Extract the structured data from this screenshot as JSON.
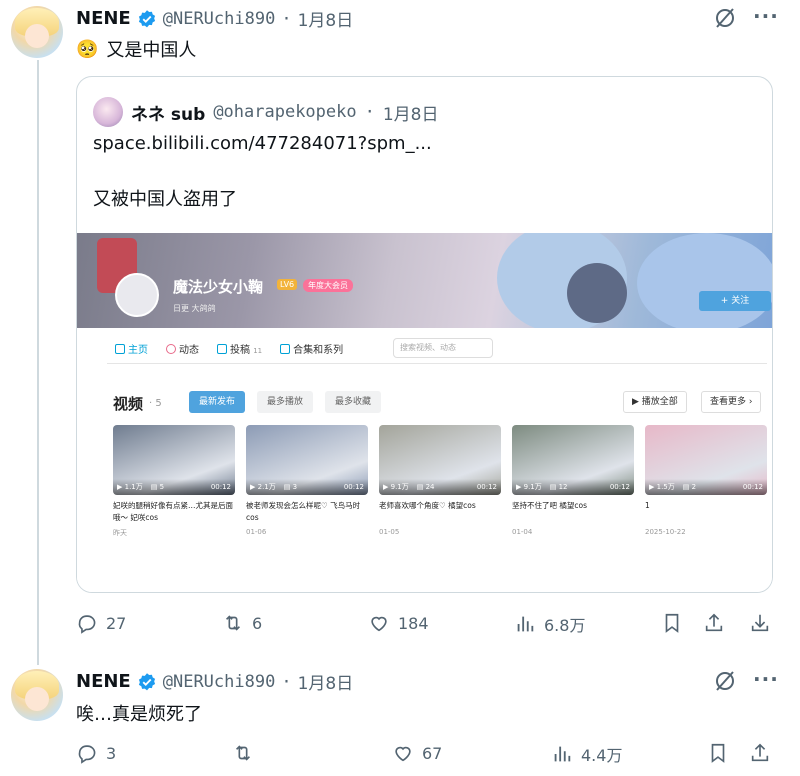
{
  "tweet1": {
    "name": "NENE",
    "handle": "@NERUchi890",
    "dot": "·",
    "date": "1月8日",
    "emoji": "🥺",
    "text": "又是中国人",
    "quote": {
      "name": "ネネ sub",
      "handle": "@oharapekopeko",
      "dot": "·",
      "date": "1月8日",
      "link": "space.bilibili.com/477284071?spm_...",
      "text": "又被中国人盗用了",
      "screenshot": {
        "up_name": "魔法少女小鞠",
        "level": "LV6",
        "vip": "年度大会员",
        "up_sub": "日更 大鸽鸽",
        "follow": "+ 关注",
        "nav": [
          {
            "label": "主页",
            "count": ""
          },
          {
            "label": "动态",
            "count": ""
          },
          {
            "label": "投稿",
            "count": "11"
          },
          {
            "label": "合集和系列",
            "count": ""
          }
        ],
        "search_placeholder": "搜索视频、动态",
        "videos_title": "视频",
        "videos_count": "· 5",
        "sort": [
          "最新发布",
          "最多播放",
          "最多收藏"
        ],
        "play_all": "▶ 播放全部",
        "see_more": "查看更多 ›",
        "videos": [
          {
            "views": "1.1万",
            "danmaku": "5",
            "duration": "00:12",
            "title": "妃咲的腿稍好像有点紧…尤其是后面哦～ 妃咲cos",
            "date": "昨天",
            "color": "#6f7c8f"
          },
          {
            "views": "2.1万",
            "danmaku": "3",
            "duration": "00:12",
            "title": "被老师发现会怎么样呢♡ 飞鸟马时cos",
            "date": "01-06",
            "color": "#8c9bb5"
          },
          {
            "views": "9.1万",
            "danmaku": "24",
            "duration": "00:12",
            "title": "老师喜欢哪个角度♡ 橘望cos",
            "date": "01-05",
            "color": "#a3a49a"
          },
          {
            "views": "9.1万",
            "danmaku": "12",
            "duration": "00:12",
            "title": "坚持不住了吧 橘望cos",
            "date": "01-04",
            "color": "#7d8b80"
          },
          {
            "views": "1.5万",
            "danmaku": "2",
            "duration": "00:12",
            "title": "1",
            "date": "2025-10-22",
            "color": "#e7b8c8"
          }
        ]
      }
    },
    "actions": {
      "reply": "27",
      "retweet": "6",
      "like": "184",
      "views": "6.8万"
    }
  },
  "tweet2": {
    "name": "NENE",
    "handle": "@NERUchi890",
    "dot": "·",
    "date": "1月8日",
    "text": "唉…真是烦死了",
    "actions": {
      "reply": "3",
      "retweet": "",
      "like": "67",
      "views": "4.4万"
    }
  },
  "colors": {
    "verified": "#1d9bf0",
    "secondary": "#536471",
    "border": "#cfd9de"
  }
}
